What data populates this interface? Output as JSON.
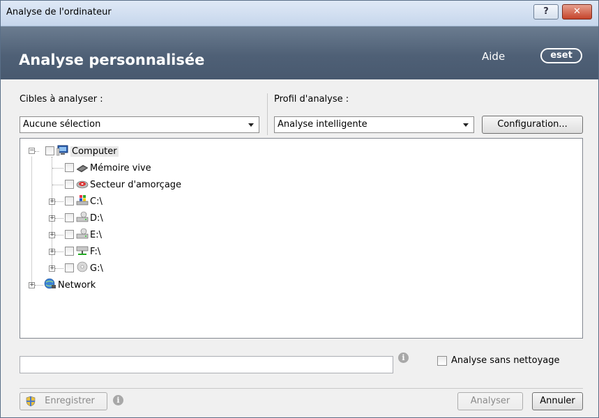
{
  "window": {
    "title": "Analyse de l'ordinateur",
    "help_button": "?",
    "close_button": "✕"
  },
  "header": {
    "title": "Analyse personnalisée",
    "help_link": "Aide",
    "logo": "eset"
  },
  "targets": {
    "label": "Cibles à analyser :",
    "selected": "Aucune sélection"
  },
  "profile": {
    "label": "Profil d'analyse :",
    "selected": "Analyse intelligente",
    "config_button": "Configuration..."
  },
  "tree": {
    "root": "Computer",
    "items": [
      {
        "label": "Mémoire vive",
        "icon": "ram-chip-icon",
        "expandable": false
      },
      {
        "label": "Secteur d'amorçage",
        "icon": "boot-sector-disk-icon",
        "expandable": false
      },
      {
        "label": "C:\\",
        "icon": "windows-drive-icon",
        "expandable": true
      },
      {
        "label": "D:\\",
        "icon": "hard-drive-icon",
        "expandable": true
      },
      {
        "label": "E:\\",
        "icon": "hard-drive-icon",
        "expandable": true
      },
      {
        "label": "F:\\",
        "icon": "network-drive-icon",
        "expandable": true
      },
      {
        "label": "G:\\",
        "icon": "cd-drive-icon",
        "expandable": true
      }
    ],
    "network": "Network"
  },
  "path_input": {
    "value": ""
  },
  "no_clean": {
    "label": "Analyse sans nettoyage",
    "checked": false
  },
  "footer": {
    "save_button": "Enregistrer",
    "scan_button": "Analyser",
    "cancel_button": "Annuler"
  },
  "colors": {
    "header_bg": "#546579",
    "titlebar_bg": "#d3e0f1",
    "close_red": "#c5442b"
  }
}
